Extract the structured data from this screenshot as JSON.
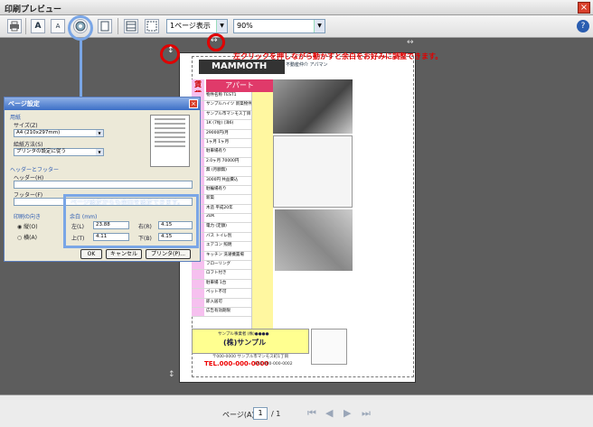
{
  "window": {
    "title": "印刷プレビュー",
    "close_label": "×"
  },
  "toolbar": {
    "print_icon": "printer-icon",
    "font_large": "A",
    "font_small": "A",
    "page_setup_icon": "gear-icon",
    "view_select": "1ページ表示",
    "zoom_select": "90%",
    "help_label": "?"
  },
  "hint": "左クリックを押しながら動かすと余白をお好みに調整できます。",
  "flyer": {
    "logo": "MAMMOTH",
    "company": "不動産仲介 アパマン",
    "chintai": "賃貸",
    "apart": "アパート",
    "rows": [
      "物件名称 TEST1",
      "サンプルハイツ 新築物件",
      "サンプル市マンモス丁目",
      "1K (7帖) (洋6)",
      "29000円/月",
      "1ヶ月 1ヶ月",
      "駐車場有り",
      "2.0ヶ月 70000円",
      "無 (月額無)",
      "3000円 共益費込",
      "駐輪場有り",
      "新築",
      "木造 平成20年",
      "2DK",
      "電力 (定額)",
      "バス トイレ別",
      "エアコン 照明",
      "キッチン 洗濯機置場",
      "フローリング",
      "ロフト付き",
      "駐車場 1台",
      "ペット不可",
      "即入居可",
      "広告有効期限"
    ],
    "footer_line1": "サンプル事業者 (株)●●●●",
    "footer_name": "(株)サンプル",
    "address": "〒000-0000 サンプル市マンモス町1丁目",
    "tel": "TEL.000-000-0000",
    "fax": "FAX.000-000-0002"
  },
  "dialog": {
    "title": "ページ設定",
    "close_label": "×",
    "paper_group": "用紙",
    "size_label": "サイズ(Z)",
    "size_value": "A4 (210x297mm)",
    "source_label": "給紙方法(S)",
    "source_value": "プリンタの設定に従う",
    "header_group": "ヘッダーとフッター",
    "header_label": "ヘッダー(H)",
    "footer_label": "フッター(F)",
    "orientation_group": "印刷の向き",
    "portrait": "縦(O)",
    "landscape": "横(A)",
    "margins_group": "余白 (mm)",
    "left_label": "左(L)",
    "left_value": "23.88",
    "right_label": "右(R)",
    "right_value": "4.15",
    "top_label": "上(T)",
    "top_value": "4.11",
    "bottom_label": "下(B)",
    "bottom_value": "4.15",
    "ok": "OK",
    "cancel": "キャンセル",
    "printer": "プリンタ(P)..."
  },
  "callout": "ページ設定からも余白を設定できます。",
  "status": {
    "page_label": "ページ(A)",
    "page_value": "1",
    "total": "/ 1"
  }
}
